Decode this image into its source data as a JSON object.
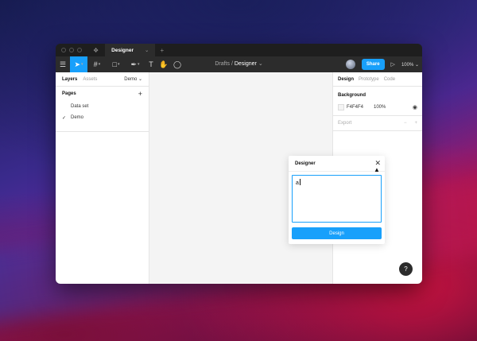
{
  "titlebar": {
    "tab_label": "Designer",
    "tab_chevron": "⌄",
    "plus": "+"
  },
  "toolbar": {
    "breadcrumb_parent": "Drafts",
    "breadcrumb_separator": "/",
    "breadcrumb_current": "Designer",
    "breadcrumb_chevron": "⌄",
    "share_label": "Share",
    "zoom_label": "100%"
  },
  "left_panel": {
    "tabs": [
      "Layers",
      "Assets"
    ],
    "page_selector": "Demo",
    "pages_title": "Pages",
    "add_page": "+",
    "pages": [
      {
        "name": "Data set",
        "selected": false
      },
      {
        "name": "Demo",
        "selected": true
      }
    ]
  },
  "right_panel": {
    "tabs": [
      "Design",
      "Prototype",
      "Code"
    ],
    "background_title": "Background",
    "background_hex": "F4F4F4",
    "background_opacity": "100%",
    "export_label": "Export",
    "export_minus": "−",
    "export_plus": "+"
  },
  "dialog": {
    "title": "Designer",
    "input_value": "a",
    "button_label": "Design"
  },
  "help": {
    "label": "?"
  },
  "colors": {
    "accent": "#18a0fb",
    "canvas": "#f4f4f4",
    "toolbar": "#2c2c2c"
  },
  "icons": [
    "menu-icon",
    "move-icon",
    "frame-icon",
    "shape-icon",
    "pen-icon",
    "text-icon",
    "hand-icon",
    "comment-icon",
    "play-icon",
    "close-icon",
    "eye-icon",
    "check-icon",
    "cursor-icon"
  ]
}
